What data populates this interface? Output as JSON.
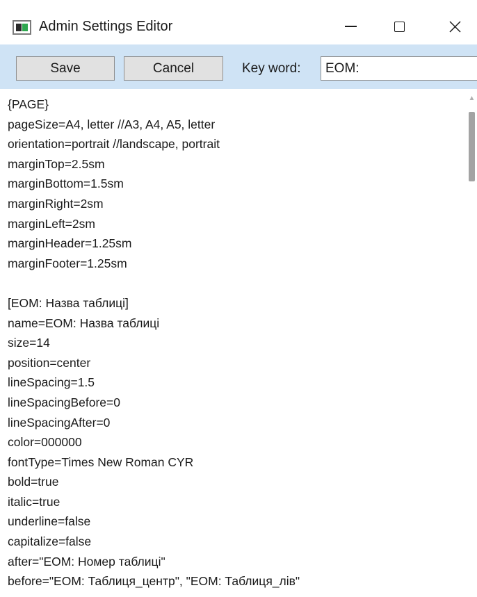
{
  "window": {
    "title": "Admin Settings Editor",
    "icon": "app-window-icon",
    "controls": {
      "minimize_icon": "minimize-icon",
      "maximize_icon": "maximize-icon",
      "close_icon": "close-icon",
      "close_glyph": "✕"
    }
  },
  "toolbar": {
    "save_label": "Save",
    "cancel_label": "Cancel",
    "keyword_label": "Key word:",
    "keyword_value": "EOM:",
    "background": "#cfe3f5"
  },
  "editor": {
    "lines": [
      "{PAGE}",
      "pageSize=A4, letter //A3, A4, A5, letter",
      "orientation=portrait //landscape, portrait",
      "marginTop=2.5sm",
      "marginBottom=1.5sm",
      "marginRight=2sm",
      "marginLeft=2sm",
      "marginHeader=1.25sm",
      "marginFooter=1.25sm",
      "",
      "[EOM: Назва таблиці]",
      "name=EOM: Назва таблиці",
      "size=14",
      "position=center",
      "lineSpacing=1.5",
      "lineSpacingBefore=0",
      "lineSpacingAfter=0",
      "color=000000",
      "fontType=Times New Roman CYR",
      "bold=true",
      "italic=true",
      "underline=false",
      "capitalize=false",
      "after=\"EOM: Номер таблиці\"",
      "before=\"EOM: Таблиця_центр\", \"EOM: Таблиця_лів\""
    ]
  },
  "scrollbar": {
    "up_arrow_icon": "scroll-up-arrow-icon",
    "up_glyph": "▲"
  }
}
